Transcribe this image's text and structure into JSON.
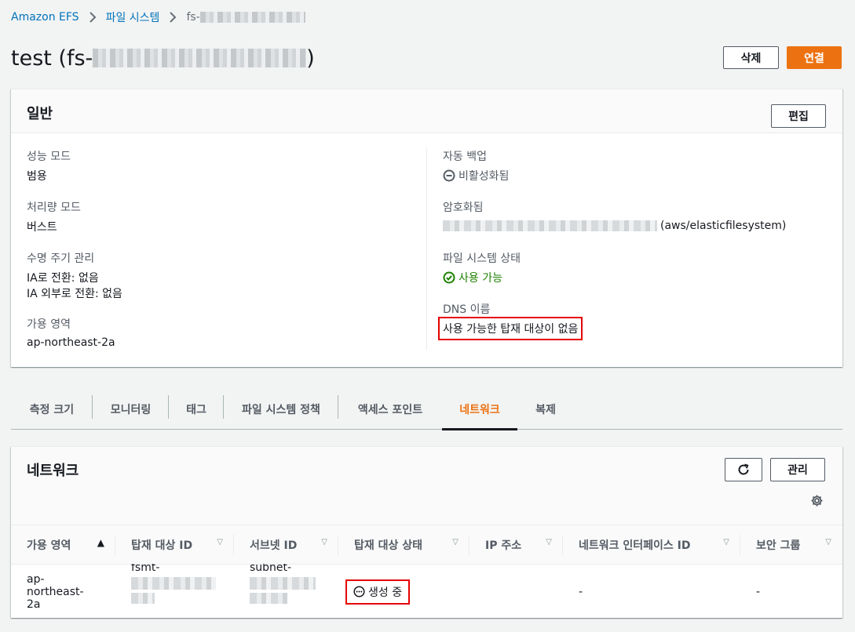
{
  "breadcrumb": {
    "root": "Amazon EFS",
    "section": "파일 시스템",
    "current_prefix": "fs-"
  },
  "page": {
    "title_prefix": "test (fs-",
    "title_suffix": ")"
  },
  "actions": {
    "delete": "삭제",
    "attach": "연결"
  },
  "general": {
    "title": "일반",
    "edit": "편집",
    "performance_mode_label": "성능 모드",
    "performance_mode_value": "범용",
    "throughput_mode_label": "처리량 모드",
    "throughput_mode_value": "버스트",
    "lifecycle_label": "수명 주기 관리",
    "lifecycle_ia": "IA로 전환: 없음",
    "lifecycle_out_ia": "IA 외부로 전환: 없음",
    "az_label": "가용 영역",
    "az_value": "ap-northeast-2a",
    "backup_label": "자동 백업",
    "backup_value": "비활성화됨",
    "encrypted_label": "암호화됨",
    "encrypted_suffix": "(aws/elasticfilesystem)",
    "fs_state_label": "파일 시스템 상태",
    "fs_state_value": "사용 가능",
    "dns_label": "DNS 이름",
    "dns_value": "사용 가능한 탑재 대상이 없음"
  },
  "tabs": [
    "측정 크기",
    "모니터링",
    "태그",
    "파일 시스템 정책",
    "액세스 포인트",
    "네트워크",
    "복제"
  ],
  "network": {
    "title": "네트워크",
    "manage": "관리",
    "columns": [
      "가용 영역",
      "탑재 대상 ID",
      "서브넷 ID",
      "탑재 대상 상태",
      "IP 주소",
      "네트워크 인터페이스 ID",
      "보안 그룹"
    ],
    "row": {
      "az_line1": "ap-northeast-",
      "az_line2": "2a",
      "mount_target_prefix": "fsmt-",
      "subnet_prefix": "subnet-",
      "state": "생성 중",
      "ip": "",
      "eni": "-",
      "sg": "-"
    }
  },
  "colors": {
    "accent": "#ec7211",
    "link": "#0073bb",
    "success": "#1d8102",
    "highlight": "#e60000"
  }
}
